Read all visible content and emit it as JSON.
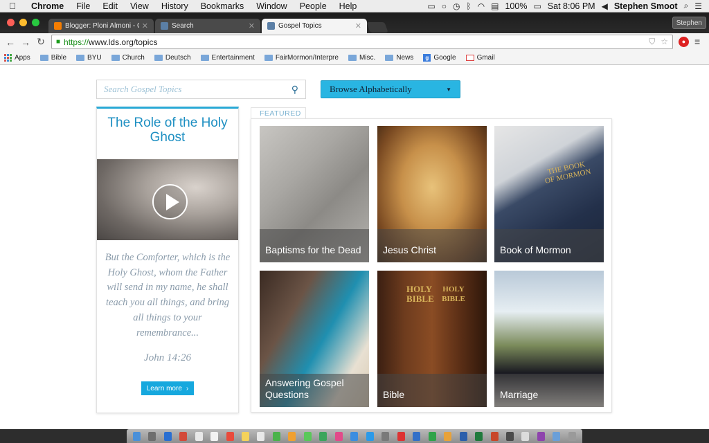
{
  "menubar": {
    "app": "Chrome",
    "items": [
      "File",
      "Edit",
      "View",
      "History",
      "Bookmarks",
      "Window",
      "People",
      "Help"
    ],
    "battery": "100%",
    "clock": "Sat 8:06 PM",
    "user": "Stephen Smoot"
  },
  "tabs": [
    {
      "title": "Blogger: Ploni Almoni - Cre",
      "color": "#f57d00"
    },
    {
      "title": "Search",
      "color": "#5b7fa6"
    },
    {
      "title": "Gospel Topics",
      "color": "#5b7fa6"
    }
  ],
  "profile": "Stephen",
  "omnibox": {
    "scheme": "https://",
    "rest": "www.lds.org/topics"
  },
  "bookmarks": [
    {
      "label": "Apps",
      "type": "apps"
    },
    {
      "label": "Bible",
      "type": "folder"
    },
    {
      "label": "BYU",
      "type": "folder"
    },
    {
      "label": "Church",
      "type": "folder"
    },
    {
      "label": "Deutsch",
      "type": "folder"
    },
    {
      "label": "Entertainment",
      "type": "folder"
    },
    {
      "label": "FairMormon/Interpre",
      "type": "folder"
    },
    {
      "label": "Misc.",
      "type": "folder"
    },
    {
      "label": "News",
      "type": "folder"
    },
    {
      "label": "Google",
      "type": "google"
    },
    {
      "label": "Gmail",
      "type": "gmail"
    }
  ],
  "search": {
    "placeholder": "Search Gospel Topics"
  },
  "browse": {
    "label": "Browse Alphabetically"
  },
  "feature": {
    "title": "The Role of the Holy Ghost",
    "quote": "But the Comforter, which is the Holy Ghost, whom the Father will send in my name, he shall teach you all things, and bring all things to your remembrance...",
    "reference": "John 14:26",
    "learn_more": "Learn more"
  },
  "featured_label": "FEATURED",
  "tiles": [
    {
      "label": "Baptisms for the Dead"
    },
    {
      "label": "Jesus Christ"
    },
    {
      "label": "Book of Mormon",
      "book_text": "THE BOOK OF MORMON"
    },
    {
      "label": "Answering Gospel Questions"
    },
    {
      "label": "Bible",
      "spine_text": "HOLY BIBLE"
    },
    {
      "label": "Marriage"
    }
  ]
}
